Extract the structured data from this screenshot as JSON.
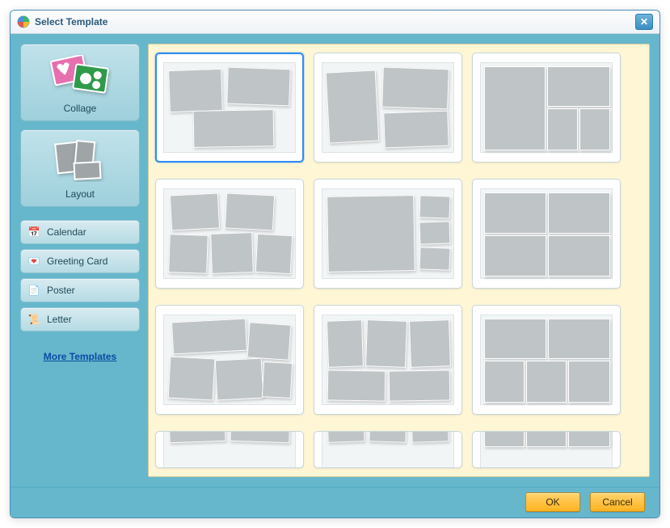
{
  "window": {
    "title": "Select Template"
  },
  "sidebar": {
    "categories": [
      {
        "id": "collage",
        "label": "Collage"
      },
      {
        "id": "layout",
        "label": "Layout"
      }
    ],
    "small_categories": [
      {
        "id": "calendar",
        "label": "Calendar",
        "icon": "calendar-icon"
      },
      {
        "id": "greeting",
        "label": "Greeting Card",
        "icon": "card-icon"
      },
      {
        "id": "poster",
        "label": "Poster",
        "icon": "poster-icon"
      },
      {
        "id": "letter",
        "label": "Letter",
        "icon": "letter-icon"
      }
    ],
    "more_link": "More Templates"
  },
  "footer": {
    "ok": "OK",
    "cancel": "Cancel"
  }
}
